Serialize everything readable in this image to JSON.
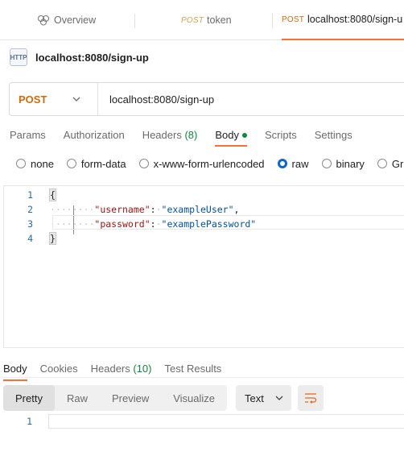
{
  "tabs": [
    {
      "label": "Overview"
    },
    {
      "method": "POST",
      "label": "token"
    },
    {
      "method": "POST",
      "label": "localhost:8080/sign-u"
    }
  ],
  "request": {
    "icon_text": "HTTP",
    "title": "localhost:8080/sign-up",
    "method": "POST",
    "url": "localhost:8080/sign-up"
  },
  "request_tabs": {
    "params": "Params",
    "authorization": "Authorization",
    "headers": "Headers",
    "headers_count": "(8)",
    "body": "Body",
    "scripts": "Scripts",
    "settings": "Settings"
  },
  "body_types": {
    "none": "none",
    "form_data": "form-data",
    "urlencoded": "x-www-form-urlencoded",
    "raw": "raw",
    "binary": "binary",
    "graphql": "Gra",
    "selected": "raw"
  },
  "editor": {
    "line_numbers": [
      "1",
      "2",
      "3",
      "4"
    ],
    "open_brace": "{",
    "close_brace": "}",
    "line2_key": "\"username\"",
    "line2_value": "\"exampleUser\"",
    "line3_key": "\"password\"",
    "line3_value": "\"examplePassword\""
  },
  "response_tabs": {
    "body": "Body",
    "cookies": "Cookies",
    "headers": "Headers",
    "headers_count": "(10)",
    "test_results": "Test Results"
  },
  "response_view": {
    "pretty": "Pretty",
    "raw": "Raw",
    "preview": "Preview",
    "visualize": "Visualize",
    "format": "Text",
    "line_number": "1"
  },
  "colors": {
    "accent": "#ff6c37",
    "method_post": "#d06d08",
    "success": "#0b8a3e",
    "radio_selected": "#0a66d6"
  }
}
